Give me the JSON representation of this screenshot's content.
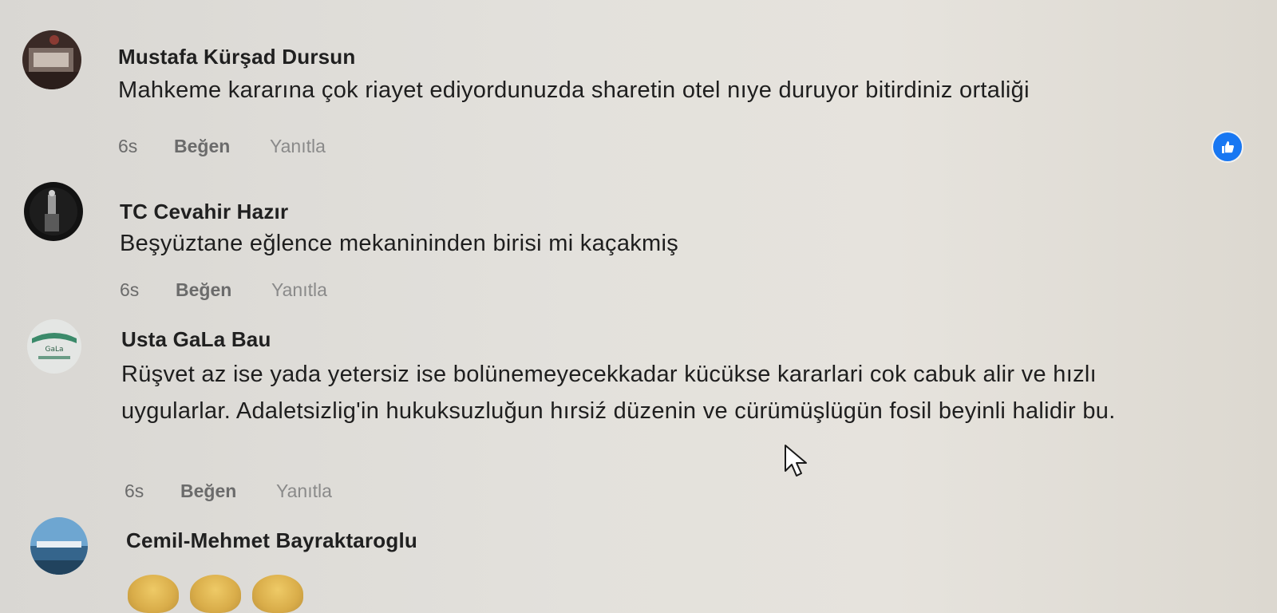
{
  "comments": [
    {
      "author": "Mustafa Kürşad Dursun",
      "text": "Mahkeme kararına çok riayet ediyordunuzda sharetin otel nıye duruyor bitirdiniz ortaliği",
      "time": "6s",
      "like_label": "Beğen",
      "reply_label": "Yanıtla",
      "reaction": "like-reaction-icon"
    },
    {
      "author": "TC Cevahir Hazır",
      "text": "Beşyüztane eğlence mekanininden birisi mi kaçakmiş",
      "time": "6s",
      "like_label": "Beğen",
      "reply_label": "Yanıtla"
    },
    {
      "author": "Usta GaLa Bau",
      "text": "Rüşvet az ise yada yetersiz ise bolünemeyecekkadar kücükse kararlari cok cabuk alir ve hızlı uygularlar. Adaletsizlig'in hukuksuzluğun hırsiź düzenin ve cürümüşlügün fosil beyinli halidir bu.",
      "time": "6s",
      "like_label": "Beğen",
      "reply_label": "Yanıtla"
    },
    {
      "author": "Cemil-Mehmet Bayraktaroglu",
      "reaction_emojis": [
        "clapping-hands-icon",
        "clapping-hands-icon",
        "thumbs-up-icon"
      ]
    }
  ],
  "colors": {
    "reaction_blue": "#1877f2",
    "meta_grey": "#6b6b6b"
  }
}
